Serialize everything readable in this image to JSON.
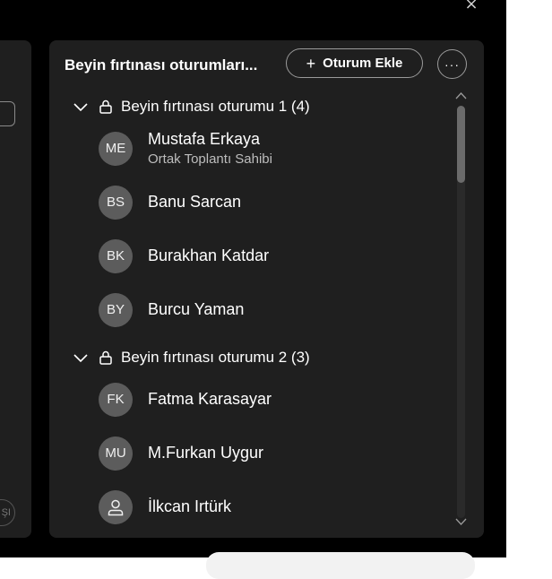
{
  "window": {
    "close_glyph": "×"
  },
  "left_panel": {
    "button_label": "ŞI"
  },
  "panel": {
    "title": "Beyin fırtınası oturumları...",
    "add_button_label": "Oturum Ekle",
    "add_button_icon": "plus-icon",
    "more_button_icon": "more-icon"
  },
  "groups": [
    {
      "label": "Beyin fırtınası oturumu 1 (4)",
      "members": [
        {
          "initials": "ME",
          "name": "Mustafa Erkaya",
          "role": "Ortak Toplantı Sahibi"
        },
        {
          "initials": "BS",
          "name": "Banu Sarcan"
        },
        {
          "initials": "BK",
          "name": "Burakhan Katdar"
        },
        {
          "initials": "BY",
          "name": "Burcu Yaman"
        }
      ]
    },
    {
      "label": "Beyin fırtınası oturumu 2 (3)",
      "members": [
        {
          "initials": "FK",
          "name": "Fatma Karasayar"
        },
        {
          "initials": "MU",
          "name": "M.Furkan Uygur"
        },
        {
          "initials": "",
          "name": "İlkcan Irtürk"
        }
      ]
    }
  ],
  "colors": {
    "background": "#000000",
    "panel": "#1f1f1f",
    "avatar": "#5c5c5c",
    "secondary_text": "#bdbdbd"
  }
}
